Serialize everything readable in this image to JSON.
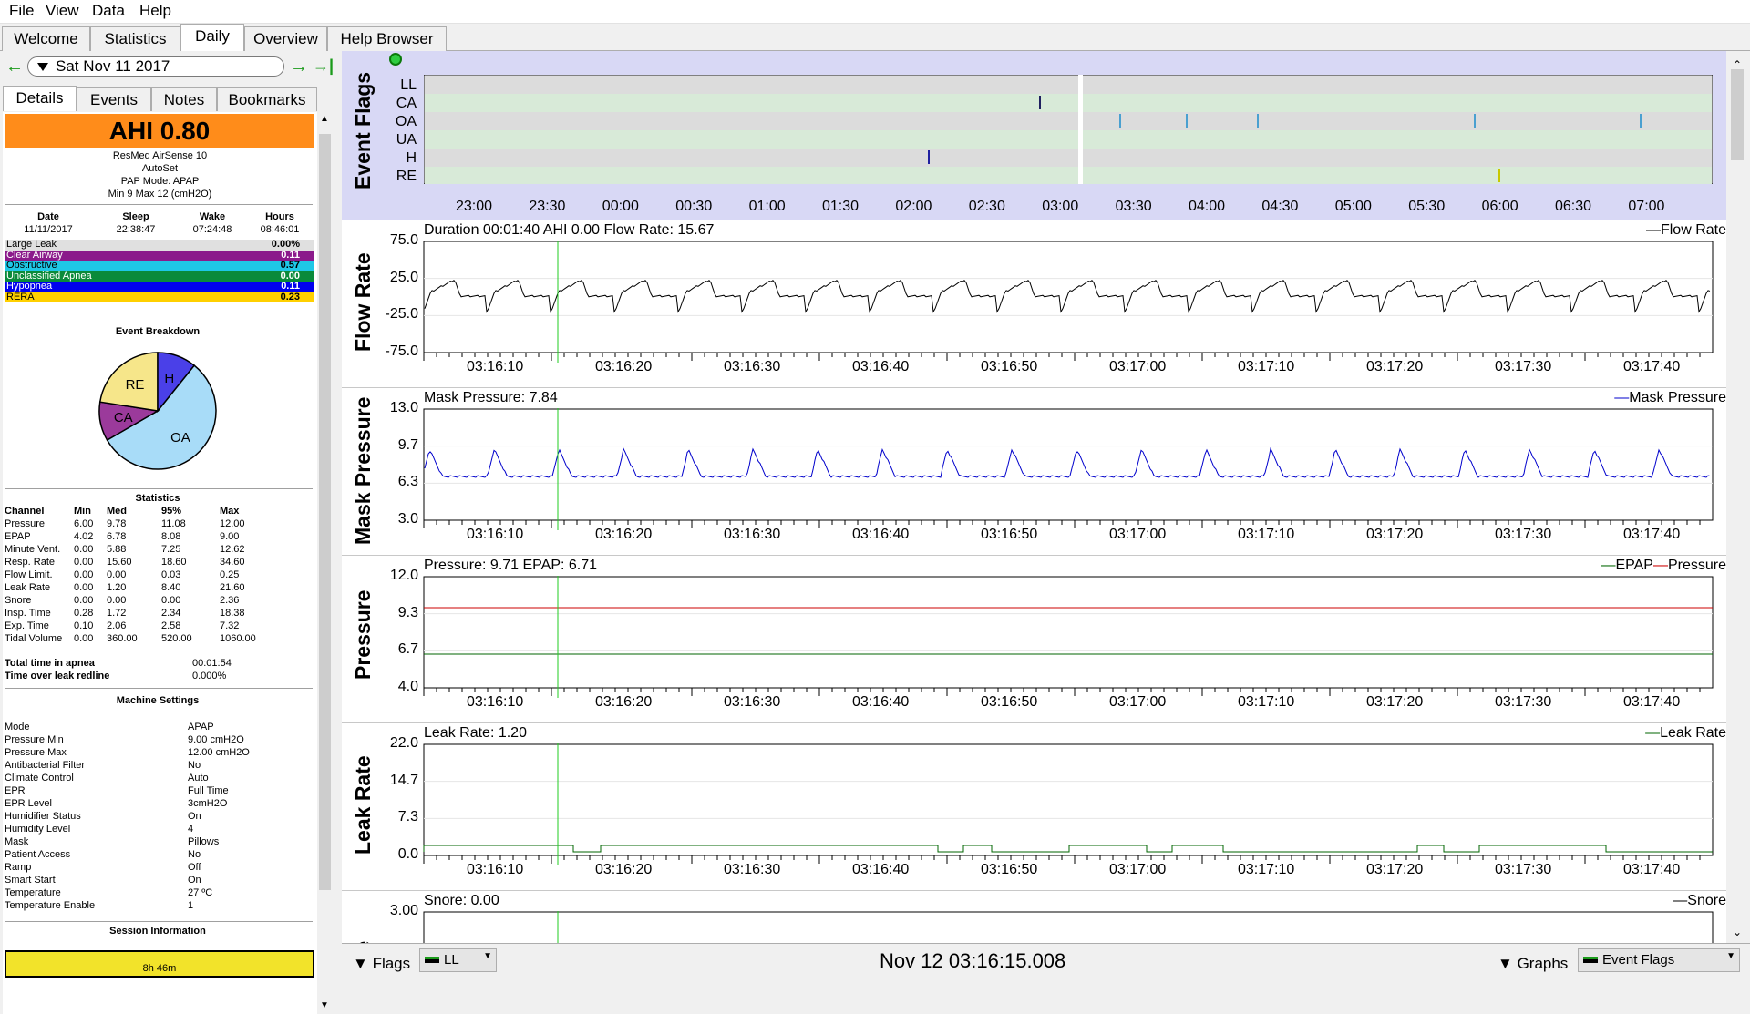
{
  "menu": [
    "File",
    "View",
    "Data",
    "Help"
  ],
  "tabs": [
    "Welcome",
    "Statistics",
    "Daily",
    "Overview",
    "Help Browser"
  ],
  "active_tab": "Daily",
  "date_selector": {
    "value": "Sat Nov 11 2017",
    "prev": "←",
    "next": "→",
    "last": "→|"
  },
  "subtabs": [
    "Details",
    "Events",
    "Notes",
    "Bookmarks"
  ],
  "ahi_banner": "AHI 0.80",
  "ahi_color": "#ff8c1a",
  "machine": {
    "model": "ResMed AirSense 10",
    "mode_name": "AutoSet",
    "pap_mode": "PAP Mode: APAP",
    "pressure_range": "Min 9 Max 12 (cmH2O)"
  },
  "session_times": {
    "headers": [
      "Date",
      "Sleep",
      "Wake",
      "Hours"
    ],
    "values": [
      "11/11/2017",
      "22:38:47",
      "07:24:48",
      "08:46:01"
    ]
  },
  "event_rows": [
    {
      "label": "Large Leak",
      "value": "0.00%",
      "color": "#e0e0e0",
      "text": "#000"
    },
    {
      "label": "Clear Airway",
      "value": "0.11",
      "color": "#8b1a8b",
      "text": "#fff"
    },
    {
      "label": "Obstructive",
      "value": "0.57",
      "color": "#1ec7e6",
      "text": "#000"
    },
    {
      "label": "Unclassified Apnea",
      "value": "0.00",
      "color": "#0a8a3a",
      "text": "#fff"
    },
    {
      "label": "Hypopnea",
      "value": "0.11",
      "color": "#0000ee",
      "text": "#fff"
    },
    {
      "label": "RERA",
      "value": "0.23",
      "color": "#ffd000",
      "text": "#000"
    }
  ],
  "event_breakdown": {
    "title": "Event Breakdown",
    "slices": [
      {
        "label": "OA",
        "value": 0.57,
        "color": "#a8dcf8"
      },
      {
        "label": "CA",
        "value": 0.11,
        "color": "#9b3a9b"
      },
      {
        "label": "RE",
        "value": 0.23,
        "color": "#f6e68a"
      },
      {
        "label": "H",
        "value": 0.11,
        "color": "#4a40e8"
      }
    ]
  },
  "statistics": {
    "title": "Statistics",
    "headers": [
      "Channel",
      "Min",
      "Med",
      "95%",
      "Max"
    ],
    "rows": [
      [
        "Pressure",
        "6.00",
        "9.78",
        "11.08",
        "12.00"
      ],
      [
        "EPAP",
        "4.02",
        "6.78",
        "8.08",
        "9.00"
      ],
      [
        "Minute Vent.",
        "0.00",
        "5.88",
        "7.25",
        "12.62"
      ],
      [
        "Resp. Rate",
        "0.00",
        "15.60",
        "18.60",
        "34.60"
      ],
      [
        "Flow Limit.",
        "0.00",
        "0.00",
        "0.03",
        "0.25"
      ],
      [
        "Leak Rate",
        "0.00",
        "1.20",
        "8.40",
        "21.60"
      ],
      [
        "Snore",
        "0.00",
        "0.00",
        "0.00",
        "2.36"
      ],
      [
        "Insp. Time",
        "0.28",
        "1.72",
        "2.34",
        "18.38"
      ],
      [
        "Exp. Time",
        "0.10",
        "2.06",
        "2.58",
        "7.32"
      ],
      [
        "Tidal Volume",
        "0.00",
        "360.00",
        "520.00",
        "1060.00"
      ]
    ],
    "apnea_label": "Total time in apnea",
    "apnea_value": "00:01:54",
    "leak_label": "Time over leak redline",
    "leak_value": "0.000%"
  },
  "machine_settings": {
    "title": "Machine Settings",
    "rows": [
      [
        "Mode",
        "APAP"
      ],
      [
        "Pressure Min",
        "9.00 cmH2O"
      ],
      [
        "Pressure Max",
        "12.00 cmH2O"
      ],
      [
        "Antibacterial Filter",
        "No"
      ],
      [
        "Climate Control",
        "Auto"
      ],
      [
        "EPR",
        "Full Time"
      ],
      [
        "EPR Level",
        "3cmH2O"
      ],
      [
        "Humidifier Status",
        "On"
      ],
      [
        "Humidity Level",
        "4"
      ],
      [
        "Mask",
        "Pillows"
      ],
      [
        "Patient Access",
        "No"
      ],
      [
        "Ramp",
        "Off"
      ],
      [
        "Smart Start",
        "On"
      ],
      [
        "Temperature",
        "27 ºC"
      ],
      [
        "Temperature Enable",
        "1"
      ]
    ]
  },
  "session_info": {
    "title": "Session Information",
    "partial": "8h 46m"
  },
  "event_flags": {
    "title": "Event Flags",
    "rows": [
      "LL",
      "CA",
      "OA",
      "UA",
      "H",
      "RE"
    ],
    "ticks": [
      "23:00",
      "23:30",
      "00:00",
      "00:30",
      "01:00",
      "01:30",
      "02:00",
      "02:30",
      "03:00",
      "03:30",
      "04:00",
      "04:30",
      "05:00",
      "05:30",
      "06:00",
      "06:30",
      "07:00"
    ]
  },
  "time_ticks": [
    "03:16:10",
    "03:16:20",
    "03:16:30",
    "03:16:40",
    "03:16:50",
    "03:17:00",
    "03:17:10",
    "03:17:20",
    "03:17:30",
    "03:17:40"
  ],
  "graphs": [
    {
      "id": "flow",
      "title": "Flow Rate",
      "header": "Duration 00:01:40 AHI 0.00 Flow Rate: 15.67",
      "legend": "Flow Rate",
      "legend_color": "#000",
      "y": [
        "75.0",
        "25.0",
        "-25.0",
        "-75.0"
      ]
    },
    {
      "id": "mask",
      "title": "Mask Pressure",
      "header": "Mask Pressure: 7.84",
      "legend": "Mask Pressure",
      "legend_color": "#0000cc",
      "y": [
        "13.0",
        "9.7",
        "6.3",
        "3.0"
      ]
    },
    {
      "id": "pressure",
      "title": "Pressure",
      "header": "Pressure: 9.71 EPAP: 6.71",
      "legend": "EPAP",
      "legend2": "Pressure",
      "legend_color": "#006600",
      "legend2_color": "#cc0000",
      "y": [
        "12.0",
        "9.3",
        "6.7",
        "4.0"
      ]
    },
    {
      "id": "leak",
      "title": "Leak Rate",
      "header": "Leak Rate: 1.20",
      "legend": "Leak Rate",
      "legend_color": "#006600",
      "y": [
        "22.0",
        "14.7",
        "7.3",
        "0.0"
      ]
    },
    {
      "id": "snore",
      "title": "Snore",
      "header": "Snore: 0.00",
      "legend": "Snore",
      "legend_color": "#000",
      "y": [
        "3.00"
      ]
    }
  ],
  "bottom": {
    "flags_label": "Flags",
    "flag_select": "LL",
    "timestamp": "Nov 12 03:16:15.008",
    "graphs_label": "Graphs",
    "graph_select": "Event Flags"
  }
}
